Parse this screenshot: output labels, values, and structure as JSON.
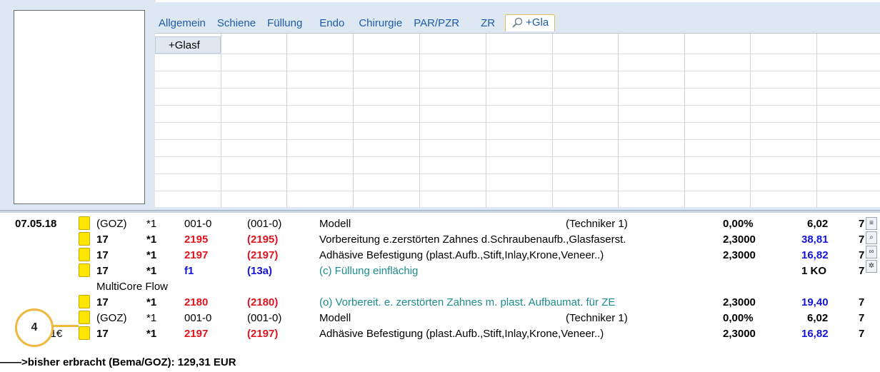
{
  "tabs": [
    {
      "label": "Allgemein"
    },
    {
      "label": "Schiene"
    },
    {
      "label": "Füllung"
    },
    {
      "label": "Endo"
    },
    {
      "label": "Chirurgie"
    },
    {
      "label": "PAR/PZR"
    },
    {
      "label": "ZR"
    },
    {
      "label": "+Gla",
      "active": true
    }
  ],
  "grid": {
    "first_cell": "+Glasf"
  },
  "entries": [
    {
      "date": "07.05.18",
      "tooth": "(GOZ)",
      "count": "*1",
      "code": "001-0",
      "code2": "(001-0)",
      "desc": "Modell",
      "extra": "(Techniker 1)",
      "factor": "0,00%",
      "amount": "6,02",
      "tail": "7"
    },
    {
      "tooth": "17",
      "count": "*1",
      "code": "2195",
      "code2": "(2195)",
      "desc": "Vorbereitung e.zerstörten Zahnes d.Schraubenaufb.,Glasfaserst.",
      "factor": "2,3000",
      "amount": "38,81",
      "tail": "7"
    },
    {
      "tooth": "17",
      "count": "*1",
      "code": "2197",
      "code2": "(2197)",
      "desc": "Adhäsive Befestigung (plast.Aufb.,Stift,Inlay,Krone,Veneer..)",
      "factor": "2,3000",
      "amount": "16,82",
      "tail": "7"
    },
    {
      "tooth": "17",
      "count": "*1",
      "code": "f1",
      "code2": "(13a)",
      "desc": "(c) Füllung einflächig",
      "amount": "1 KO",
      "tail": "7"
    },
    {
      "note": "MultiCore Flow"
    },
    {
      "tooth": "17",
      "count": "*1",
      "code": "2180",
      "code2": "(2180)",
      "desc": "(o) Vorbereit. e. zerstörten Zahnes m. plast. Aufbaumat. für ZE",
      "factor": "2,3000",
      "amount": "19,40",
      "tail": "7"
    },
    {
      "tooth": "(GOZ)",
      "count": "*1",
      "code": "001-0",
      "code2": "(001-0)",
      "desc": "Modell",
      "extra": "(Techniker 1)",
      "factor": "0,00%",
      "amount": "6,02",
      "tail": "7"
    },
    {
      "date": "129,31€",
      "tooth": "17",
      "count": "*1",
      "code": "2197",
      "code2": "(2197)",
      "desc": "Adhäsive Befestigung (plast.Aufb.,Stift,Inlay,Krone,Veneer..)",
      "factor": "2,3000",
      "amount": "16,82",
      "tail": "7"
    }
  ],
  "summary": "——>bisher erbracht (Bema/GOZ): 129,31 EUR",
  "callout": "4",
  "colors": {
    "code_red": "#e0141e",
    "blue": "#1414d8",
    "teal": "#1d8c8c",
    "marker_yellow": "#ffe600",
    "callout_orange": "#f0b83c"
  }
}
